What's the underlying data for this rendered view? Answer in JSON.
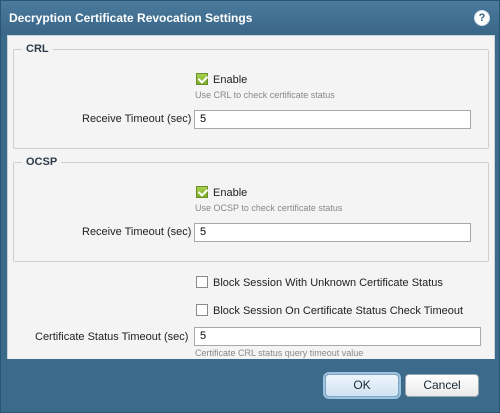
{
  "dialog": {
    "title": "Decryption Certificate Revocation Settings",
    "help_icon": "help-icon",
    "help_glyph": "?"
  },
  "crl": {
    "legend": "CRL",
    "enable_label": "Enable",
    "enable_checked": true,
    "enable_hint": "Use CRL to check certificate status",
    "timeout_label": "Receive Timeout (sec)",
    "timeout_value": "5"
  },
  "ocsp": {
    "legend": "OCSP",
    "enable_label": "Enable",
    "enable_checked": true,
    "enable_hint": "Use OCSP to check certificate status",
    "timeout_label": "Receive Timeout (sec)",
    "timeout_value": "5"
  },
  "block_unknown": {
    "label": "Block Session With Unknown Certificate Status",
    "checked": false
  },
  "block_timeout": {
    "label": "Block Session On Certificate Status Check Timeout",
    "checked": false
  },
  "cert_status_timeout": {
    "label": "Certificate Status Timeout (sec)",
    "value": "5",
    "hint": "Certificate CRL status query timeout value"
  },
  "buttons": {
    "ok": "OK",
    "cancel": "Cancel"
  },
  "colors": {
    "titlebar": "#3b6a8b",
    "checkbox_checked": "#8dbd37",
    "body_bg": "#f4f4f4"
  }
}
